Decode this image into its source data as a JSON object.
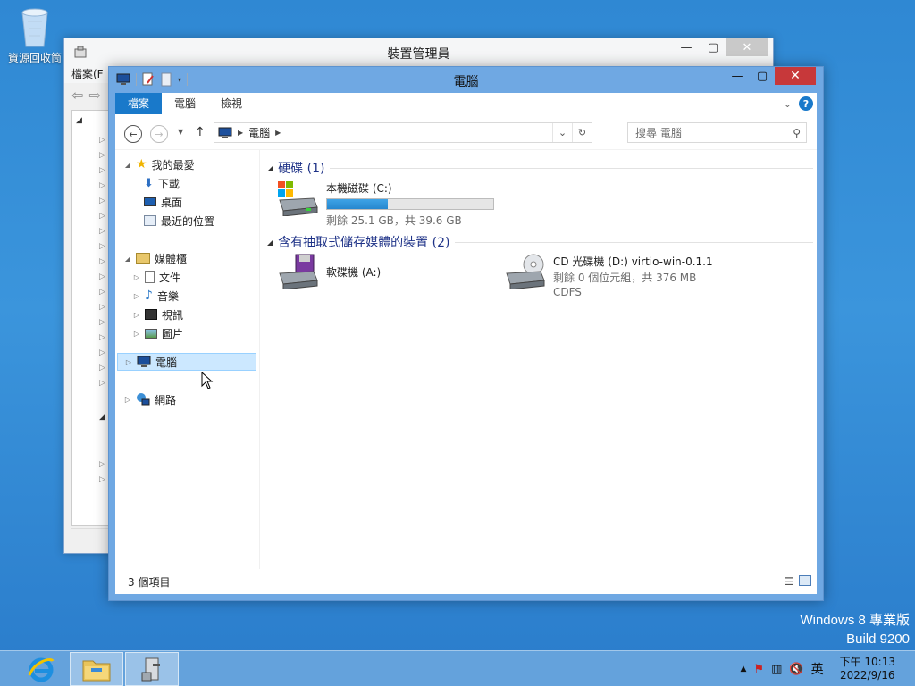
{
  "desktop": {
    "recycle_bin_label": "資源回收筒"
  },
  "device_manager": {
    "title": "裝置管理員",
    "menu_first": "檔案(F"
  },
  "explorer": {
    "title": "電腦",
    "ribbon_tabs": [
      "檔案",
      "電腦",
      "檢視"
    ],
    "address": {
      "location": "電腦"
    },
    "search": {
      "placeholder": "搜尋 電腦"
    },
    "nav": {
      "favorites": "我的最愛",
      "downloads": "下載",
      "desktop": "桌面",
      "recent": "最近的位置",
      "libraries": "媒體櫃",
      "documents": "文件",
      "music": "音樂",
      "videos": "視訊",
      "pictures": "圖片",
      "computer": "電腦",
      "network": "網路"
    },
    "groups": {
      "hard_disks": "硬碟 (1)",
      "removable": "含有抽取式儲存媒體的裝置 (2)"
    },
    "drives": {
      "c": {
        "name": "本機磁碟 (C:)",
        "free": "剩餘 25.1 GB，共 39.6 GB",
        "used_fraction": 0.366
      },
      "a": {
        "name": "軟碟機 (A:)"
      },
      "d": {
        "name": "CD 光碟機 (D:) virtio-win-0.1.1",
        "free": "剩餘 0 個位元組，共 376 MB",
        "fs": "CDFS"
      }
    },
    "status": {
      "item_count": "3 個項目"
    }
  },
  "watermark": {
    "line1": "Windows 8 專業版",
    "line2": "Build 9200"
  },
  "taskbar": {
    "ime": "英",
    "time": "下午 10:13",
    "date": "2022/9/16"
  }
}
